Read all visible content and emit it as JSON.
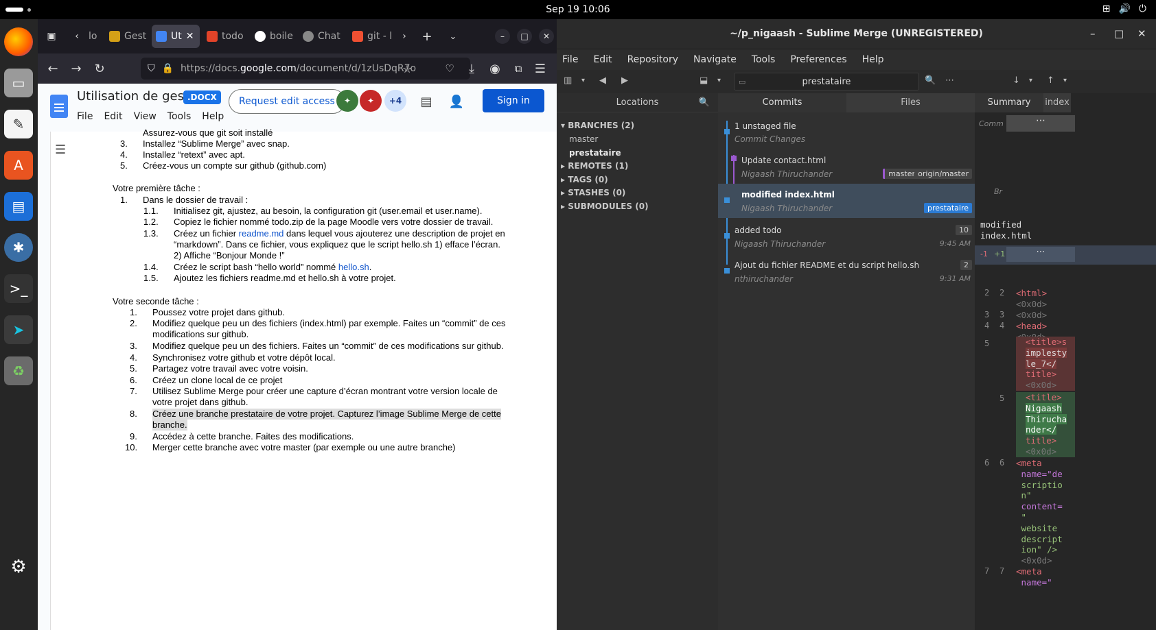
{
  "topbar": {
    "clock": "Sep 19  10:06"
  },
  "firefox": {
    "tabs": [
      {
        "label": "lo",
        "color": "#888"
      },
      {
        "label": "Gest",
        "color": "#d4a017"
      },
      {
        "label": "Ut",
        "color": "#4285f4"
      },
      {
        "label": "todo",
        "color": "#e24329"
      },
      {
        "label": "boile",
        "color": "#ffffff"
      },
      {
        "label": "Chat",
        "color": "#aaa"
      },
      {
        "label": "git - l",
        "color": "#f05032"
      }
    ],
    "url_prefix": "https://docs.",
    "url_domain": "google.com",
    "url_suffix": "/document/d/1zUsDqR7o"
  },
  "gdocs": {
    "title": "Utilisation de ges...",
    "badge": ".DOCX",
    "menu": [
      "File",
      "Edit",
      "View",
      "Tools",
      "Help"
    ],
    "request_edit": "Request edit access",
    "more_users": "+4",
    "sign_in": "Sign in"
  },
  "doc": {
    "l0": "Assurez-vous que git soit installé",
    "l1n": "3.",
    "l1": "Installez “Sublime Merge” avec snap.",
    "l2n": "4.",
    "l2": "Installez “retext” avec apt.",
    "l3n": "5.",
    "l3": "Créez-vous un compte sur github (github.com)",
    "h1": "Votre première tâche :",
    "a1n": "1.",
    "a1": "Dans le dossier de travail :",
    "b1n": "1.1.",
    "b1": "Initialisez git, ajustez, au besoin, la configuration git (user.email et user.name).",
    "b2n": "1.2.",
    "b2": "Copiez le fichier nommé todo.zip de la page Moodle vers votre dossier de travail.",
    "b3n": "1.3.",
    "b3a": "Créez un fichier ",
    "b3link": "readme.md",
    "b3b": " dans lequel vous ajouterez une description de projet en",
    "b3c": "“markdown”. Dans ce fichier, vous expliquez que le script hello.sh 1) efface l’écran.",
    "b3d": "2) Affiche “Bonjour Monde !”",
    "b4n": "1.4.",
    "b4a": "Créez le script bash “hello world” nommé ",
    "b4link": "hello.sh",
    "b4b": ".",
    "b5n": "1.5.",
    "b5": "Ajoutez les fichiers readme.md et hello.sh à votre projet.",
    "h2": "Votre seconde tâche :",
    "s1n": "1.",
    "s1": "Poussez votre projet dans github.",
    "s2n": "2.",
    "s2": "Modifiez quelque peu un des fichiers (index.html) par exemple.  Faites un “commit” de ces",
    "s2b": "modifications sur github.",
    "s3n": "3.",
    "s3": "Modifiez quelque peu un des fichiers.  Faites un “commit” de ces modifications sur github.",
    "s4n": "4.",
    "s4": "Synchronisez votre github et votre dépôt local.",
    "s5n": "5.",
    "s5": "Partagez votre travail avec votre voisin.",
    "s6n": "6.",
    "s6": "Créez un clone local de ce projet",
    "s7n": "7.",
    "s7": "Utilisez Sublime Merge pour créer une capture d’écran montrant votre version locale de",
    "s7b": "votre projet dans github.",
    "s8n": "8.",
    "s8": "Créez une branche prestataire de votre projet.  Capturez l’image Sublime Merge de cette",
    "s8b": "branche.",
    "s9n": "9.",
    "s9": "Accédez à cette branche. Faites des modifications.",
    "s10n": "10.",
    "s10": "Merger cette branche avec votre master (par exemple ou une autre branche)"
  },
  "sm": {
    "title": "~/p_nigaash - Sublime Merge (UNREGISTERED)",
    "menu": [
      "File",
      "Edit",
      "Repository",
      "Navigate",
      "Tools",
      "Preferences",
      "Help"
    ],
    "search_value": "prestataire",
    "locations": "Locations",
    "branches": "BRANCHES (2)",
    "branch_items": [
      "master",
      "prestataire"
    ],
    "remotes": "REMOTES (1)",
    "tags": "TAGS (0)",
    "stashes": "STASHES (0)",
    "submodules": "SUBMODULES (0)",
    "tab_commits": "Commits",
    "tab_files": "Files",
    "tab_summary": "Summary",
    "tab_index": "index",
    "commits": [
      {
        "title": "1 unstaged file",
        "author": "Commit Changes"
      },
      {
        "title": "Update contact.html",
        "author": "Nigaash Thiruchander",
        "badge1": "master",
        "badge2": "origin/master"
      },
      {
        "title": "modified index.html",
        "author": "Nigaash Thiruchander",
        "badge1": "prestataire"
      },
      {
        "title": "added todo",
        "author": "Nigaash Thiruchander",
        "count": "10",
        "time": "9:45 AM"
      },
      {
        "title": "Ajout du fichier README et du script hello.sh",
        "author": "nthiruchander",
        "count": "2",
        "time": "9:31 AM"
      }
    ],
    "summary": {
      "comm": "Comm",
      "br": "Br",
      "msg1": "modified",
      "msg2": "index.html",
      "minus": "-1",
      "plus": "+1"
    },
    "diff": {
      "n2": "2",
      "n3": "3",
      "n4": "4",
      "n5": "5",
      "n6": "6",
      "n7": "7",
      "c_html": "<html>",
      "c_cr": "<0x0d>",
      "c_head": "<head>",
      "c_title_old_a": "<title>s",
      "c_title_old_b": "implesty",
      "c_title_old_c": "le_7</",
      "c_title_old_d": "title>",
      "c_title_new_a": "<title>",
      "c_title_new_b": "Nigaash",
      "c_title_new_c": "Thirucha",
      "c_title_new_d": "nder</",
      "c_title_new_e": "title>",
      "c_meta_a": "<meta",
      "c_meta_b": "name=\"de",
      "c_meta_c": "scriptio",
      "c_meta_d": "n\"",
      "c_meta_e": "content=",
      "c_meta_f": "\"",
      "c_meta_g": "website",
      "c_meta_h": "descript",
      "c_meta_i": "ion\" />",
      "c_meta2_a": "<meta",
      "c_meta2_b": "name=\""
    }
  }
}
